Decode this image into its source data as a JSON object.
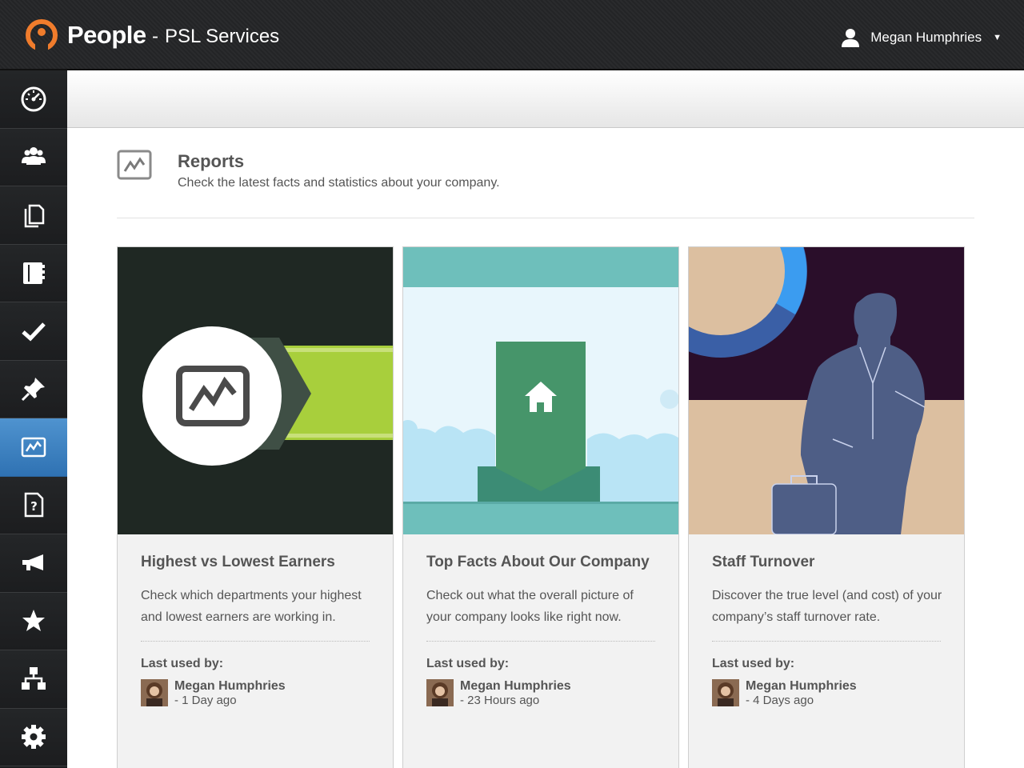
{
  "header": {
    "brand": "People",
    "separator": "-",
    "organization": "PSL Services",
    "user_name": "Megan Humphries",
    "accent": "#f07c2c"
  },
  "sidebar": {
    "items": [
      {
        "name": "dashboard",
        "icon": "dashboard-icon"
      },
      {
        "name": "people",
        "icon": "people-icon"
      },
      {
        "name": "documents",
        "icon": "documents-icon"
      },
      {
        "name": "directory",
        "icon": "book-icon"
      },
      {
        "name": "tasks",
        "icon": "checkmark-icon"
      },
      {
        "name": "pins",
        "icon": "pin-icon"
      },
      {
        "name": "reports",
        "icon": "reports-icon",
        "active": true
      },
      {
        "name": "help",
        "icon": "help-document-icon"
      },
      {
        "name": "announcements",
        "icon": "megaphone-icon"
      },
      {
        "name": "favourites",
        "icon": "star-icon"
      },
      {
        "name": "org-chart",
        "icon": "org-chart-icon"
      },
      {
        "name": "settings",
        "icon": "gear-icon"
      }
    ],
    "active_color": "#3b7fc0"
  },
  "page": {
    "title": "Reports",
    "description": "Check the latest facts and statistics about your company."
  },
  "last_used_label": "Last used by:",
  "cards": [
    {
      "title": "Highest vs Lowest Earners",
      "description": "Check which departments your highest and lowest earners are working in.",
      "user": "Megan Humphries",
      "when": "- 1 Day ago"
    },
    {
      "title": "Top Facts About Our Company",
      "description": "Check out what the overall picture of your company looks like right now.",
      "user": "Megan Humphries",
      "when": "- 23 Hours ago"
    },
    {
      "title": "Staff Turnover",
      "description": "Discover the true level (and cost) of your company’s staff turnover rate.",
      "user": "Megan Humphries",
      "when": "- 4 Days ago"
    }
  ]
}
